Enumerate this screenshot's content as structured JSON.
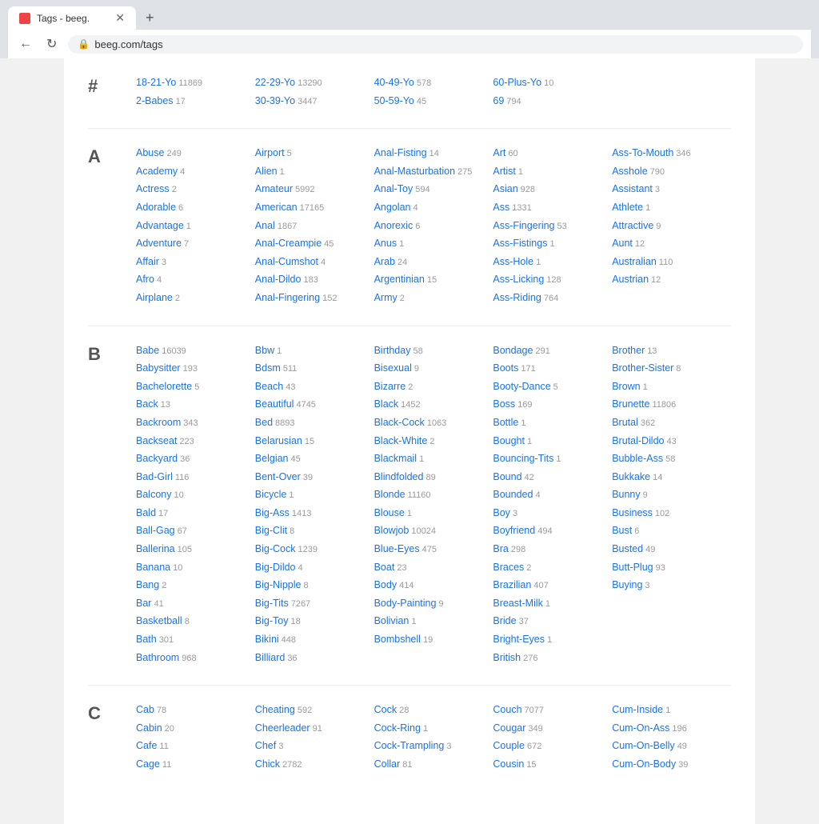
{
  "browser": {
    "tab_title": "Tags - beeg.",
    "url": "beeg.com/tags",
    "new_tab_label": "+",
    "nav_back": "←",
    "nav_reload": "↻"
  },
  "sections": [
    {
      "letter": "#",
      "columns": [
        [
          {
            "name": "18-21-Yo",
            "count": "11869"
          },
          {
            "name": "2-Babes",
            "count": "17"
          }
        ],
        [
          {
            "name": "22-29-Yo",
            "count": "13290"
          },
          {
            "name": "30-39-Yo",
            "count": "3447"
          }
        ],
        [
          {
            "name": "40-49-Yo",
            "count": "578"
          },
          {
            "name": "50-59-Yo",
            "count": "45"
          }
        ],
        [
          {
            "name": "60-Plus-Yo",
            "count": "10"
          },
          {
            "name": "69",
            "count": "794"
          }
        ],
        []
      ]
    },
    {
      "letter": "A",
      "columns": [
        [
          {
            "name": "Abuse",
            "count": "249"
          },
          {
            "name": "Academy",
            "count": "4"
          },
          {
            "name": "Actress",
            "count": "2"
          },
          {
            "name": "Adorable",
            "count": "6"
          },
          {
            "name": "Advantage",
            "count": "1"
          },
          {
            "name": "Adventure",
            "count": "7"
          },
          {
            "name": "Affair",
            "count": "3"
          },
          {
            "name": "Afro",
            "count": "4"
          },
          {
            "name": "Airplane",
            "count": "2"
          }
        ],
        [
          {
            "name": "Airport",
            "count": "5"
          },
          {
            "name": "Alien",
            "count": "1"
          },
          {
            "name": "Amateur",
            "count": "5992"
          },
          {
            "name": "American",
            "count": "17165"
          },
          {
            "name": "Anal",
            "count": "1867"
          },
          {
            "name": "Anal-Creampie",
            "count": "45"
          },
          {
            "name": "Anal-Cumshot",
            "count": "4"
          },
          {
            "name": "Anal-Dildo",
            "count": "183"
          },
          {
            "name": "Anal-Fingering",
            "count": "152"
          }
        ],
        [
          {
            "name": "Anal-Fisting",
            "count": "14"
          },
          {
            "name": "Anal-Masturbation",
            "count": "275"
          },
          {
            "name": "Anal-Toy",
            "count": "594"
          },
          {
            "name": "Angolan",
            "count": "4"
          },
          {
            "name": "Anorexic",
            "count": "6"
          },
          {
            "name": "Anus",
            "count": "1"
          },
          {
            "name": "Arab",
            "count": "24"
          },
          {
            "name": "Argentinian",
            "count": "15"
          },
          {
            "name": "Army",
            "count": "2"
          }
        ],
        [
          {
            "name": "Art",
            "count": "60"
          },
          {
            "name": "Artist",
            "count": "1"
          },
          {
            "name": "Asian",
            "count": "928"
          },
          {
            "name": "Ass",
            "count": "1331"
          },
          {
            "name": "Ass-Fingering",
            "count": "53"
          },
          {
            "name": "Ass-Fistings",
            "count": "1"
          },
          {
            "name": "Ass-Hole",
            "count": "1"
          },
          {
            "name": "Ass-Licking",
            "count": "128"
          },
          {
            "name": "Ass-Riding",
            "count": "764"
          }
        ],
        [
          {
            "name": "Ass-To-Mouth",
            "count": "346"
          },
          {
            "name": "Asshole",
            "count": "790"
          },
          {
            "name": "Assistant",
            "count": "3"
          },
          {
            "name": "Athlete",
            "count": "1"
          },
          {
            "name": "Attractive",
            "count": "9"
          },
          {
            "name": "Aunt",
            "count": "12"
          },
          {
            "name": "Australian",
            "count": "110"
          },
          {
            "name": "Austrian",
            "count": "12"
          }
        ]
      ]
    },
    {
      "letter": "B",
      "columns": [
        [
          {
            "name": "Babe",
            "count": "16039"
          },
          {
            "name": "Babysitter",
            "count": "193"
          },
          {
            "name": "Bachelorette",
            "count": "5"
          },
          {
            "name": "Back",
            "count": "13"
          },
          {
            "name": "Backroom",
            "count": "343"
          },
          {
            "name": "Backseat",
            "count": "223"
          },
          {
            "name": "Backyard",
            "count": "36"
          },
          {
            "name": "Bad-Girl",
            "count": "116"
          },
          {
            "name": "Balcony",
            "count": "10"
          },
          {
            "name": "Bald",
            "count": "17"
          },
          {
            "name": "Ball-Gag",
            "count": "67"
          },
          {
            "name": "Ballerina",
            "count": "105"
          },
          {
            "name": "Banana",
            "count": "10"
          },
          {
            "name": "Bang",
            "count": "2"
          },
          {
            "name": "Bar",
            "count": "41"
          },
          {
            "name": "Basketball",
            "count": "8"
          },
          {
            "name": "Bath",
            "count": "301"
          },
          {
            "name": "Bathroom",
            "count": "968"
          }
        ],
        [
          {
            "name": "Bbw",
            "count": "1"
          },
          {
            "name": "Bdsm",
            "count": "511"
          },
          {
            "name": "Beach",
            "count": "43"
          },
          {
            "name": "Beautiful",
            "count": "4745"
          },
          {
            "name": "Bed",
            "count": "8893"
          },
          {
            "name": "Belarusian",
            "count": "15"
          },
          {
            "name": "Belgian",
            "count": "45"
          },
          {
            "name": "Bent-Over",
            "count": "39"
          },
          {
            "name": "Bicycle",
            "count": "1"
          },
          {
            "name": "Big-Ass",
            "count": "1413"
          },
          {
            "name": "Big-Clit",
            "count": "8"
          },
          {
            "name": "Big-Cock",
            "count": "1239"
          },
          {
            "name": "Big-Dildo",
            "count": "4"
          },
          {
            "name": "Big-Nipple",
            "count": "8"
          },
          {
            "name": "Big-Tits",
            "count": "7267"
          },
          {
            "name": "Big-Toy",
            "count": "18"
          },
          {
            "name": "Bikini",
            "count": "448"
          },
          {
            "name": "Billiard",
            "count": "36"
          }
        ],
        [
          {
            "name": "Birthday",
            "count": "58"
          },
          {
            "name": "Bisexual",
            "count": "9"
          },
          {
            "name": "Bizarre",
            "count": "2"
          },
          {
            "name": "Black",
            "count": "1452"
          },
          {
            "name": "Black-Cock",
            "count": "1063"
          },
          {
            "name": "Black-White",
            "count": "2"
          },
          {
            "name": "Blackmail",
            "count": "1"
          },
          {
            "name": "Blindfolded",
            "count": "89"
          },
          {
            "name": "Blonde",
            "count": "11160"
          },
          {
            "name": "Blouse",
            "count": "1"
          },
          {
            "name": "Blowjob",
            "count": "10024"
          },
          {
            "name": "Blue-Eyes",
            "count": "475"
          },
          {
            "name": "Boat",
            "count": "23"
          },
          {
            "name": "Body",
            "count": "414"
          },
          {
            "name": "Body-Painting",
            "count": "9"
          },
          {
            "name": "Bolivian",
            "count": "1"
          },
          {
            "name": "Bombshell",
            "count": "19"
          }
        ],
        [
          {
            "name": "Bondage",
            "count": "291"
          },
          {
            "name": "Boots",
            "count": "171"
          },
          {
            "name": "Booty-Dance",
            "count": "5"
          },
          {
            "name": "Boss",
            "count": "169"
          },
          {
            "name": "Bottle",
            "count": "1"
          },
          {
            "name": "Bought",
            "count": "1"
          },
          {
            "name": "Bouncing-Tits",
            "count": "1"
          },
          {
            "name": "Bound",
            "count": "42"
          },
          {
            "name": "Bounded",
            "count": "4"
          },
          {
            "name": "Boy",
            "count": "3"
          },
          {
            "name": "Boyfriend",
            "count": "494"
          },
          {
            "name": "Bra",
            "count": "298"
          },
          {
            "name": "Braces",
            "count": "2"
          },
          {
            "name": "Brazilian",
            "count": "407"
          },
          {
            "name": "Breast-Milk",
            "count": "1"
          },
          {
            "name": "Bride",
            "count": "37"
          },
          {
            "name": "Bright-Eyes",
            "count": "1"
          },
          {
            "name": "British",
            "count": "276"
          }
        ],
        [
          {
            "name": "Brother",
            "count": "13"
          },
          {
            "name": "Brother-Sister",
            "count": "8"
          },
          {
            "name": "Brown",
            "count": "1"
          },
          {
            "name": "Brunette",
            "count": "11806"
          },
          {
            "name": "Brutal",
            "count": "362"
          },
          {
            "name": "Brutal-Dildo",
            "count": "43"
          },
          {
            "name": "Bubble-Ass",
            "count": "58"
          },
          {
            "name": "Bukkake",
            "count": "14"
          },
          {
            "name": "Bunny",
            "count": "9"
          },
          {
            "name": "Business",
            "count": "102"
          },
          {
            "name": "Bust",
            "count": "6"
          },
          {
            "name": "Busted",
            "count": "49"
          },
          {
            "name": "Butt-Plug",
            "count": "93"
          },
          {
            "name": "Buying",
            "count": "3"
          }
        ]
      ]
    },
    {
      "letter": "C",
      "columns": [
        [
          {
            "name": "Cab",
            "count": "78"
          },
          {
            "name": "Cabin",
            "count": "20"
          },
          {
            "name": "Cafe",
            "count": "11"
          },
          {
            "name": "Cage",
            "count": "11"
          }
        ],
        [
          {
            "name": "Cheating",
            "count": "592"
          },
          {
            "name": "Cheerleader",
            "count": "91"
          },
          {
            "name": "Chef",
            "count": "3"
          },
          {
            "name": "Chick",
            "count": "2782"
          }
        ],
        [
          {
            "name": "Cock",
            "count": "28"
          },
          {
            "name": "Cock-Ring",
            "count": "1"
          },
          {
            "name": "Cock-Trampling",
            "count": "3"
          },
          {
            "name": "Collar",
            "count": "81"
          }
        ],
        [
          {
            "name": "Couch",
            "count": "7077"
          },
          {
            "name": "Cougar",
            "count": "349"
          },
          {
            "name": "Couple",
            "count": "672"
          },
          {
            "name": "Cousin",
            "count": "15"
          }
        ],
        [
          {
            "name": "Cum-Inside",
            "count": "1"
          },
          {
            "name": "Cum-On-Ass",
            "count": "196"
          },
          {
            "name": "Cum-On-Belly",
            "count": "49"
          },
          {
            "name": "Cum-On-Body",
            "count": "39"
          }
        ]
      ]
    }
  ]
}
